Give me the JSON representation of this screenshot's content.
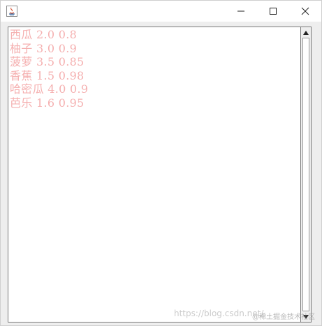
{
  "window": {
    "title": "",
    "icons": {
      "app": "java-app-icon",
      "minimize": "minimize-icon",
      "maximize": "maximize-icon",
      "close": "close-icon"
    }
  },
  "textarea": {
    "lines": [
      "西瓜 2.0 0.8",
      "柚子 3.0 0.9",
      "菠萝 3.5 0.85",
      "香蕉 1.5 0.98",
      "哈密瓜 4.0 0.9",
      "芭乐 1.6 0.95"
    ],
    "text_color": "#f5b0b0"
  },
  "watermark": {
    "url": "https://blog.csdn.net/...",
    "badge": "@稀土掘金技术社区"
  }
}
